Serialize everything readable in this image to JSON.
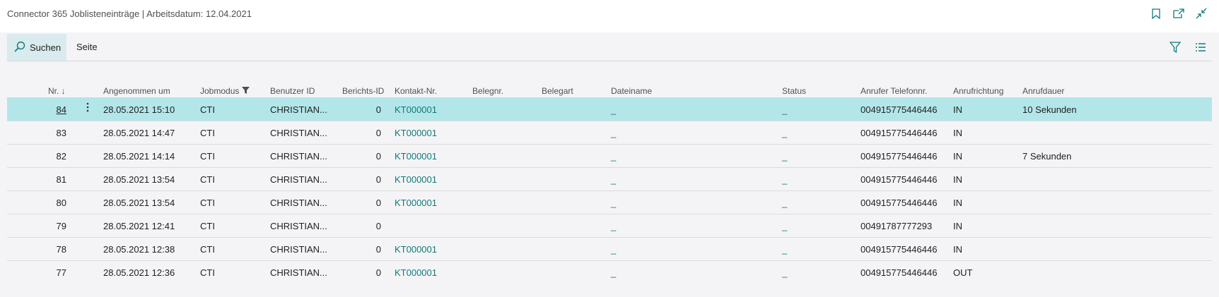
{
  "window": {
    "title": "Connector 365 Joblisteneinträge | Arbeitsdatum: 12.04.2021",
    "icons": [
      "bookmark-icon",
      "open-new-window-icon",
      "collapse-icon"
    ]
  },
  "actionbar": {
    "search_label": "Suchen",
    "page_label": "Seite",
    "tools": [
      "filter-icon",
      "list-view-icon"
    ]
  },
  "columns": {
    "nr": "Nr. ↓",
    "angenommen": "Angenommen um",
    "jobmodus": "Jobmodus",
    "benutzer": "Benutzer ID",
    "berichts": "Berichts-ID",
    "kontakt": "Kontakt-Nr.",
    "belegnr": "Belegnr.",
    "belegart": "Belegart",
    "dateiname": "Dateiname",
    "status": "Status",
    "anrufer": "Anrufer Telefonnr.",
    "richtung": "Anrufrichtung",
    "dauer": "Anrufdauer"
  },
  "rows": [
    {
      "nr": "84",
      "angenommen": "28.05.2021 15:10",
      "jobmodus": "CTI",
      "benutzer": "CHRISTIAN...",
      "berichts": "0",
      "kontakt": "KT000001",
      "dateiname": "_",
      "status": "_",
      "anrufer": "004915775446446",
      "richtung": "IN",
      "dauer": "10 Sekunden",
      "selected": true
    },
    {
      "nr": "83",
      "angenommen": "28.05.2021 14:47",
      "jobmodus": "CTI",
      "benutzer": "CHRISTIAN...",
      "berichts": "0",
      "kontakt": "KT000001",
      "dateiname": "_",
      "status": "_",
      "anrufer": "004915775446446",
      "richtung": "IN",
      "dauer": ""
    },
    {
      "nr": "82",
      "angenommen": "28.05.2021 14:14",
      "jobmodus": "CTI",
      "benutzer": "CHRISTIAN...",
      "berichts": "0",
      "kontakt": "KT000001",
      "dateiname": "_",
      "status": "_",
      "anrufer": "004915775446446",
      "richtung": "IN",
      "dauer": "7 Sekunden"
    },
    {
      "nr": "81",
      "angenommen": "28.05.2021 13:54",
      "jobmodus": "CTI",
      "benutzer": "CHRISTIAN...",
      "berichts": "0",
      "kontakt": "KT000001",
      "dateiname": "_",
      "status": "_",
      "anrufer": "004915775446446",
      "richtung": "IN",
      "dauer": ""
    },
    {
      "nr": "80",
      "angenommen": "28.05.2021 13:54",
      "jobmodus": "CTI",
      "benutzer": "CHRISTIAN...",
      "berichts": "0",
      "kontakt": "KT000001",
      "dateiname": "_",
      "status": "_",
      "anrufer": "004915775446446",
      "richtung": "IN",
      "dauer": ""
    },
    {
      "nr": "79",
      "angenommen": "28.05.2021 12:41",
      "jobmodus": "CTI",
      "benutzer": "CHRISTIAN...",
      "berichts": "0",
      "kontakt": "",
      "dateiname": "_",
      "status": "_",
      "anrufer": "00491787777293",
      "richtung": "IN",
      "dauer": ""
    },
    {
      "nr": "78",
      "angenommen": "28.05.2021 12:38",
      "jobmodus": "CTI",
      "benutzer": "CHRISTIAN...",
      "berichts": "0",
      "kontakt": "KT000001",
      "dateiname": "_",
      "status": "_",
      "anrufer": "004915775446446",
      "richtung": "IN",
      "dauer": ""
    },
    {
      "nr": "77",
      "angenommen": "28.05.2021 12:36",
      "jobmodus": "CTI",
      "benutzer": "CHRISTIAN...",
      "berichts": "0",
      "kontakt": "KT000001",
      "dateiname": "_",
      "status": "_",
      "anrufer": "004915775446446",
      "richtung": "OUT",
      "dauer": ""
    }
  ],
  "colors": {
    "accent": "#117a7a",
    "selected_row": "#b3e6e9",
    "search_bg": "#d9ebee"
  }
}
